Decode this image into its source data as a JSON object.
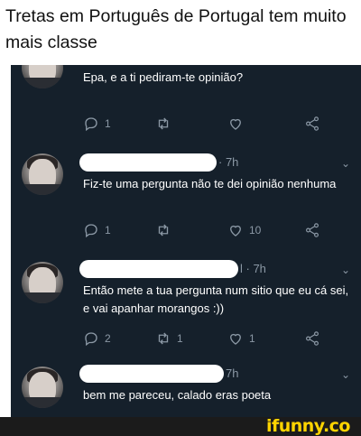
{
  "caption": "Tretas em Português de Portugal tem muito mais classe",
  "tweets": [
    {
      "meta": "",
      "text": "Epa, e a ti pediram-te opinião?",
      "actions": {
        "reply": "1",
        "retweet": "",
        "like": "",
        "share": ""
      }
    },
    {
      "meta": "· 7h",
      "text": "Fiz-te uma pergunta não te dei opinião nenhuma",
      "actions": {
        "reply": "1",
        "retweet": "",
        "like": "10",
        "share": ""
      }
    },
    {
      "meta": "l · 7h",
      "text": "Então mete a tua pergunta num sitio que eu cá sei, e vai apanhar morangos :))",
      "actions": {
        "reply": "2",
        "retweet": "1",
        "like": "1",
        "share": ""
      }
    },
    {
      "meta": "7h",
      "text": "bem me pareceu, calado eras poeta",
      "actions": {
        "reply": "",
        "retweet": "",
        "like": "",
        "share": ""
      }
    }
  ],
  "watermark": "ifunny.co",
  "icons": {
    "reply": "reply-icon",
    "retweet": "retweet-icon",
    "like": "heart-icon",
    "share": "share-icon",
    "more": "chevron-down-icon"
  },
  "colors": {
    "background": "#15202b",
    "muted": "#8b98a5",
    "text": "#ffffff",
    "watermark": "#ffd400"
  }
}
